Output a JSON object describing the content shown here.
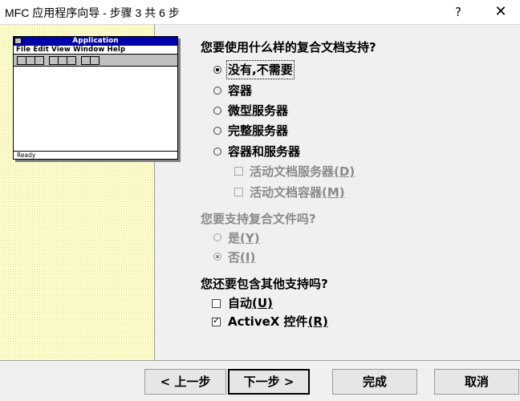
{
  "window": {
    "title": "MFC 应用程序向导 - 步骤 3 共 6 步",
    "help_label": "?",
    "close_label": "✕"
  },
  "preview": {
    "app_title": "Application",
    "menu_text": "File Edit View Window Help",
    "status_text": "Ready"
  },
  "compound": {
    "question": "您要使用什么样的复合文档支持?",
    "options": [
      {
        "label": "没有,不需要",
        "selected": true
      },
      {
        "label": "容器",
        "selected": false
      },
      {
        "label": "微型服务器",
        "selected": false
      },
      {
        "label": "完整服务器",
        "selected": false
      },
      {
        "label": "容器和服务器",
        "selected": false
      }
    ],
    "sub_options": [
      {
        "label": "活动文档服务器",
        "hotkey": "(D)",
        "checked": false
      },
      {
        "label": "活动文档容器",
        "hotkey": "(M)",
        "checked": false
      }
    ]
  },
  "compound_files": {
    "question": "您要支持复合文件吗?",
    "options": [
      {
        "label": "是",
        "hotkey": "(Y)",
        "selected": false
      },
      {
        "label": "否",
        "hotkey": "(I)",
        "selected": true
      }
    ]
  },
  "other_support": {
    "question": "您还要包含其他支持吗?",
    "options": [
      {
        "label": "自动",
        "hotkey": "(U)",
        "checked": false
      },
      {
        "label": "ActiveX 控件",
        "hotkey": "(R)",
        "checked": true
      }
    ]
  },
  "buttons": {
    "back": "< 上一步",
    "next": "下一步 >",
    "finish": "完成",
    "cancel": "取消"
  }
}
